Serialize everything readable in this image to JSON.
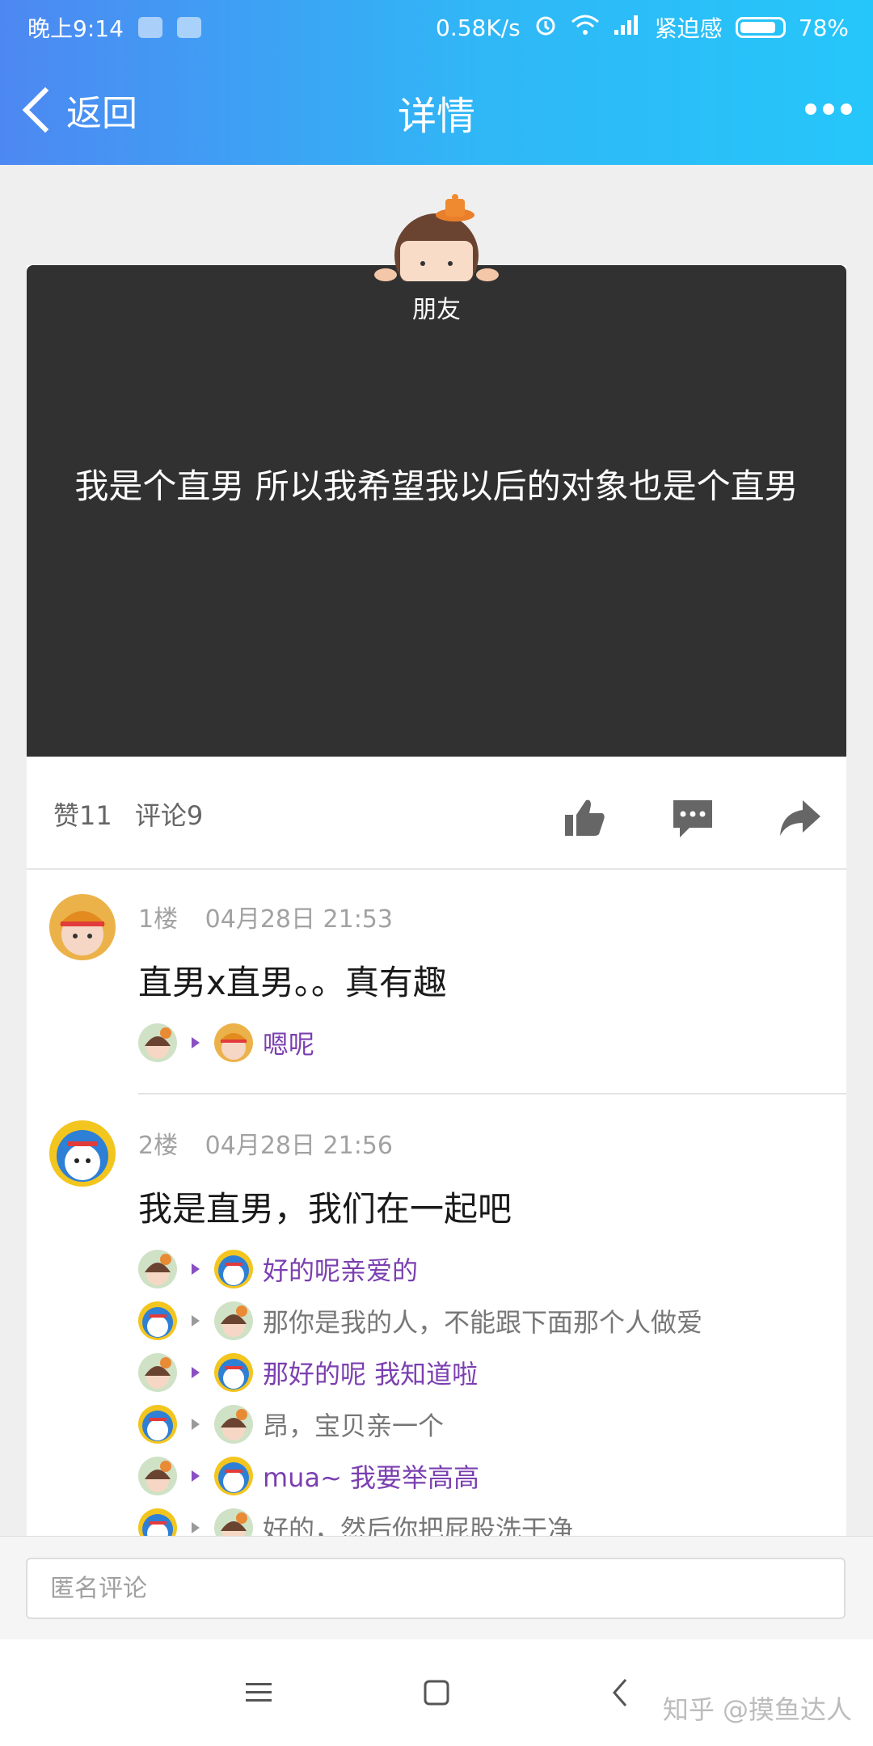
{
  "status": {
    "time": "晚上9:14",
    "speed": "0.58K/s",
    "mode": "紧迫感",
    "battery": "78%"
  },
  "nav": {
    "back_label": "返回",
    "title": "详情"
  },
  "post": {
    "tag": "朋友",
    "text": "我是个直男 所以我希望我以后的对象也是个直男",
    "likes": "赞11",
    "comments": "评论9"
  },
  "comments": [
    {
      "floor": "1楼",
      "time": "04月28日 21:53",
      "text": "直男x直男。。真有趣",
      "replies": [
        {
          "text": "嗯呢",
          "style": "purple"
        }
      ]
    },
    {
      "floor": "2楼",
      "time": "04月28日 21:56",
      "text": "我是直男，我们在一起吧",
      "replies": [
        {
          "text": "好的呢亲爱的",
          "style": "purple"
        },
        {
          "text": "那你是我的人，不能跟下面那个人做爱",
          "style": "grey"
        },
        {
          "text": "那好的呢 我知道啦",
          "style": "purple"
        },
        {
          "text": "昂，宝贝亲一个",
          "style": "grey"
        },
        {
          "text": "mua~ 我要举高高",
          "style": "purple"
        },
        {
          "text": "好的，然后你把屁股洗干净",
          "style": "grey"
        }
      ]
    }
  ],
  "input": {
    "placeholder": "匿名评论"
  },
  "watermark": "知乎 @摸鱼达人",
  "icons": {
    "like": "thumb-up-icon",
    "comment": "comment-icon",
    "share": "share-icon",
    "menu": "menu-icon",
    "home": "home-icon",
    "back": "back-icon"
  }
}
